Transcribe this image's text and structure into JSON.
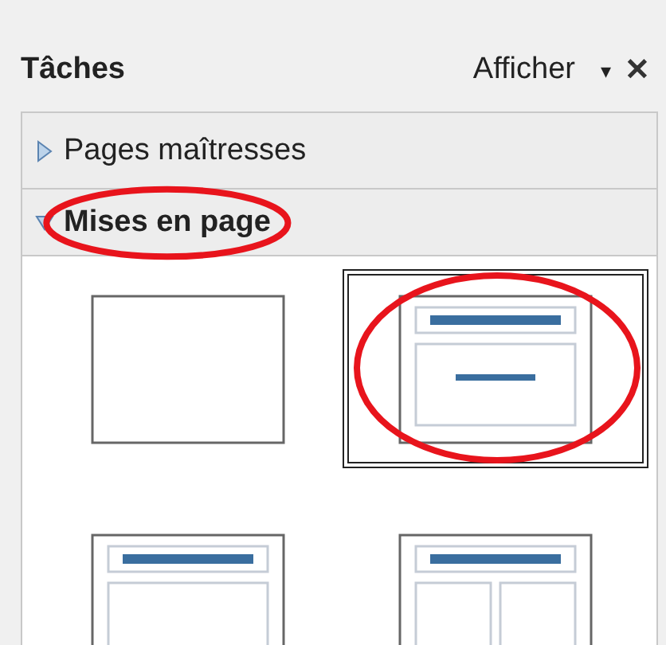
{
  "panel": {
    "title": "Tâches",
    "view_menu": "Afficher",
    "dropdown": "▾",
    "close": "✕"
  },
  "sections": [
    {
      "label": "Pages maîtresses",
      "expanded": false,
      "annotated": false
    },
    {
      "label": "Mises en page",
      "expanded": true,
      "annotated": true
    }
  ],
  "layouts": [
    {
      "kind": "blank",
      "selected": false,
      "annotated": false
    },
    {
      "kind": "title-centered-text",
      "selected": true,
      "annotated": true
    },
    {
      "kind": "title-content",
      "selected": false,
      "annotated": false
    },
    {
      "kind": "title-two-columns",
      "selected": false,
      "annotated": false
    }
  ]
}
